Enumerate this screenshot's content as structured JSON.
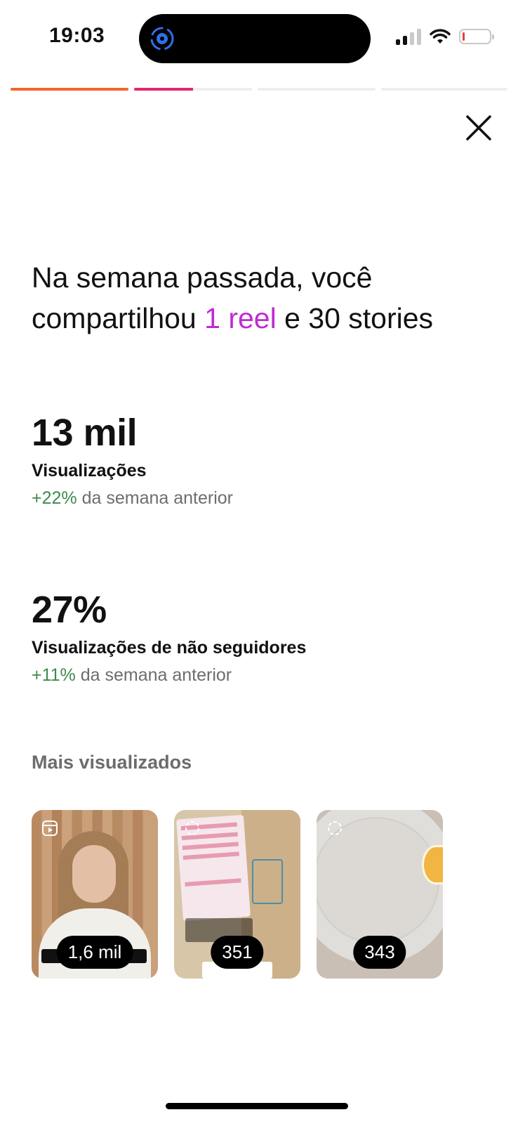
{
  "status_bar": {
    "time": "19:03"
  },
  "story_progress": [
    {
      "fill_fraction": 1.0,
      "color": "#f2652c"
    },
    {
      "fill_fraction": 0.5,
      "color": "#e0286f"
    },
    {
      "fill_fraction": 0.0,
      "color": "#eeeeee"
    },
    {
      "fill_fraction": 0.0,
      "color": "#eeeeee"
    }
  ],
  "headline": {
    "part1": "Na semana passada, você compartilhou ",
    "accent": "1 reel",
    "part2": " e 30 stories"
  },
  "stats": [
    {
      "value": "13 mil",
      "label": "Visualizações",
      "change": "+22%",
      "change_suffix": " da semana anterior"
    },
    {
      "value": "27%",
      "label": "Visualizações de não seguidores",
      "change": "+11%",
      "change_suffix": " da semana anterior"
    }
  ],
  "most_viewed": {
    "title": "Mais visualizados",
    "items": [
      {
        "type": "reel-icon",
        "views": "1,6 mil"
      },
      {
        "type": "story-icon",
        "views": "351"
      },
      {
        "type": "story-icon",
        "views": "343"
      }
    ]
  },
  "colors": {
    "accent": "#c02ad3",
    "positive": "#3d8a4e"
  }
}
